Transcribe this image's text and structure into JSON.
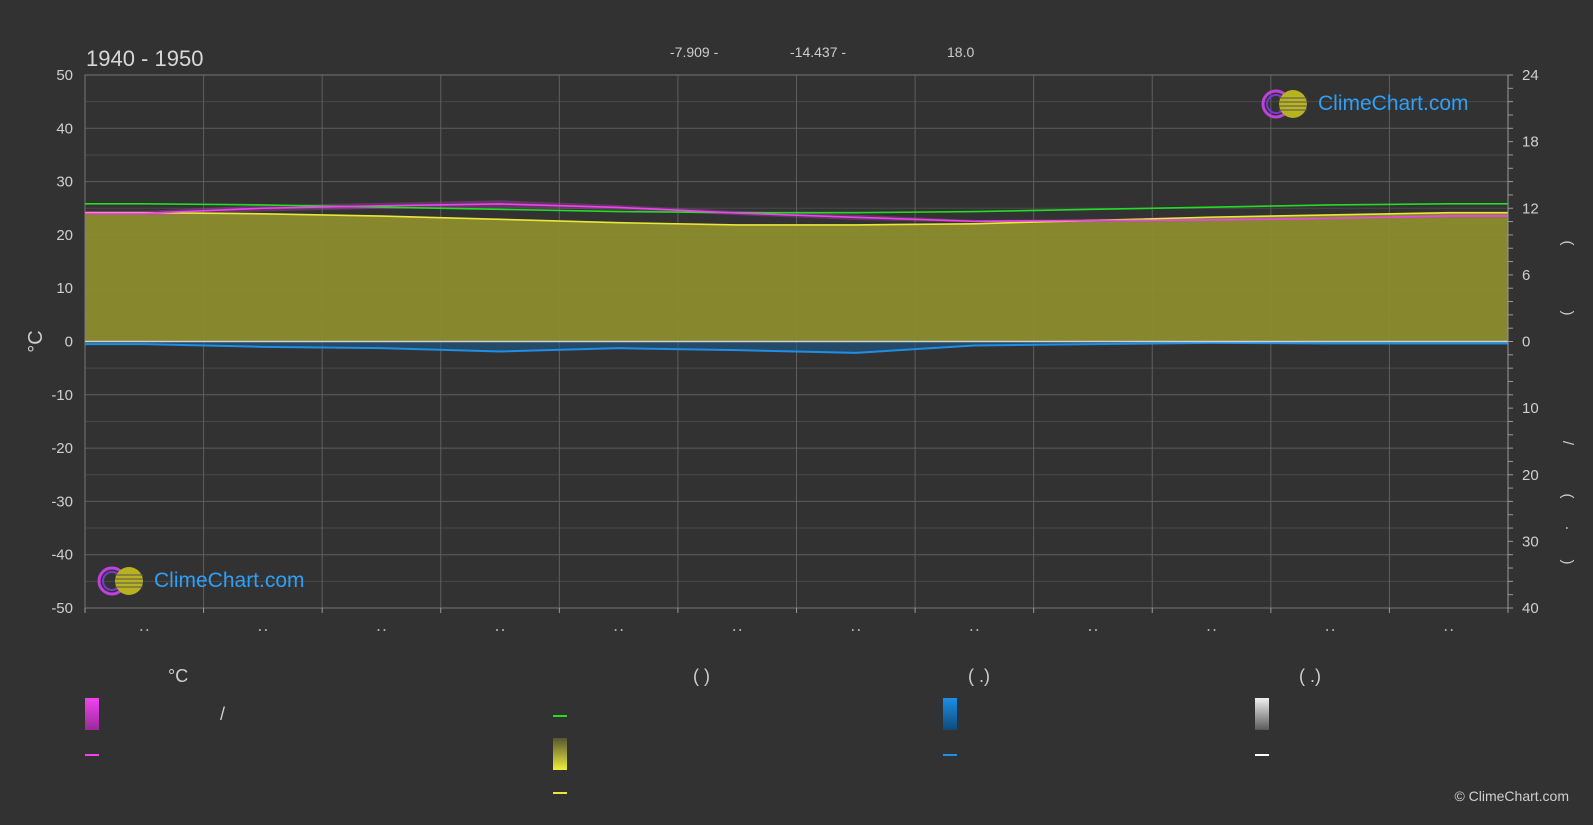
{
  "header": {
    "period": "1940 - 1950",
    "lat": "-7.909 -",
    "lon": "-14.437 -",
    "elev": "18.0"
  },
  "brand": {
    "name": "ClimeChart.com",
    "copyright": "© ClimeChart.com"
  },
  "legend": {
    "col1_unit": "°C",
    "col1_slash": "/",
    "col2_paren": "(          )",
    "col3_paren": "(    .)",
    "col4_paren": "(    .)"
  },
  "colors": {
    "background": "#323232",
    "sunshine_fill": "#8c8c2e",
    "daylight": "#22dd22",
    "sunshine_line": "#e8e83a",
    "temperature": "#ee44ee",
    "precipitation": "#1e8ee6",
    "snow": "#ffffff"
  },
  "chart_data": {
    "type": "line",
    "x_ticks": 12,
    "left_axis": {
      "label": "°C",
      "ticks": [
        50,
        40,
        30,
        20,
        10,
        0,
        -10,
        -20,
        -30,
        -40,
        -50
      ],
      "ylim": [
        -50,
        50
      ]
    },
    "right_axis_top": {
      "ticks": [
        24,
        18,
        12,
        6,
        0
      ],
      "ylim": [
        0,
        24
      ]
    },
    "right_axis_bottom": {
      "ticks": [
        0,
        10,
        20,
        30,
        40
      ],
      "ylim": [
        0,
        40
      ]
    },
    "right_axis_markers": [
      "(",
      ")",
      "/",
      "(",
      "·",
      ")"
    ],
    "series": [
      {
        "key": "daylight",
        "axis": "right_top",
        "values": [
          12.4,
          12.3,
          12.1,
          11.9,
          11.7,
          11.6,
          11.6,
          11.7,
          11.9,
          12.1,
          12.3,
          12.4
        ]
      },
      {
        "key": "sunshine",
        "axis": "right_top",
        "values": [
          11.6,
          11.5,
          11.3,
          11.0,
          10.7,
          10.5,
          10.5,
          10.6,
          10.9,
          11.2,
          11.4,
          11.6
        ]
      },
      {
        "key": "temp_max",
        "axis": "left",
        "values": [
          24.5,
          25.6,
          26.0,
          26.5,
          25.6,
          24.5,
          23.8,
          22.8,
          23.0,
          23.0,
          23.2,
          23.8
        ]
      },
      {
        "key": "temp_min",
        "axis": "left",
        "values": [
          23.6,
          24.4,
          24.9,
          25.1,
          24.7,
          23.7,
          22.8,
          22.3,
          22.4,
          22.6,
          23.0,
          23.3
        ]
      },
      {
        "key": "rain",
        "axis": "right_bottom",
        "values": [
          0.4,
          0.8,
          1.0,
          1.5,
          1.0,
          1.3,
          1.7,
          0.6,
          0.4,
          0.2,
          0.3,
          0.3
        ]
      }
    ]
  }
}
